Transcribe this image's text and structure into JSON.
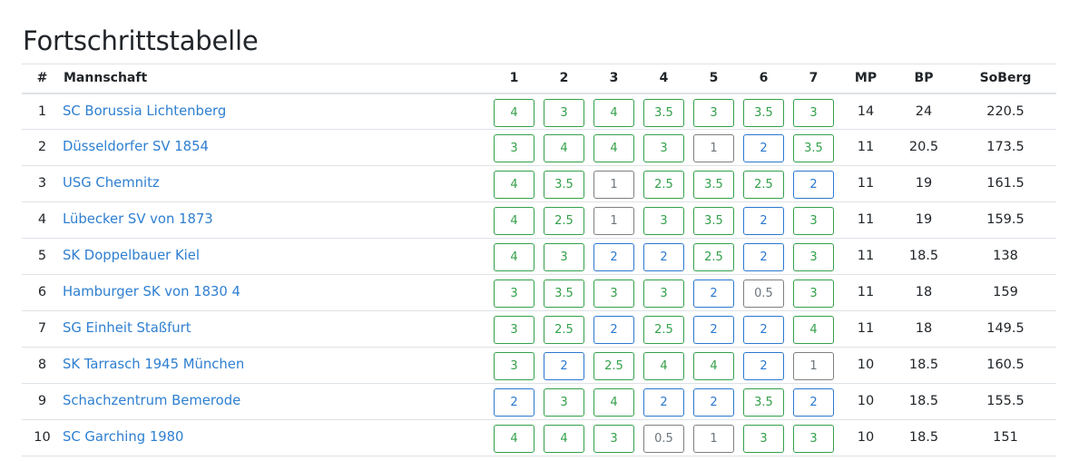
{
  "title": "Fortschrittstabelle",
  "headers": {
    "rank": "#",
    "team": "Mannschaft",
    "rounds": [
      "1",
      "2",
      "3",
      "4",
      "5",
      "6",
      "7"
    ],
    "mp": "MP",
    "bp": "BP",
    "soberg": "SoBerg"
  },
  "colors": {
    "win": "#33a04a",
    "draw": "#2b78cf",
    "loss": "#7f7f7f",
    "link": "#2e7fd1"
  },
  "rows": [
    {
      "rank": "1",
      "team": "SC Borussia Lichtenberg",
      "results": [
        "4",
        "3",
        "4",
        "3.5",
        "3",
        "3.5",
        "3"
      ],
      "status": [
        "win",
        "win",
        "win",
        "win",
        "win",
        "win",
        "win"
      ],
      "mp": "14",
      "bp": "24",
      "soberg": "220.5"
    },
    {
      "rank": "2",
      "team": "Düsseldorfer SV 1854",
      "results": [
        "3",
        "4",
        "4",
        "3",
        "1",
        "2",
        "3.5"
      ],
      "status": [
        "win",
        "win",
        "win",
        "win",
        "loss",
        "draw",
        "win"
      ],
      "mp": "11",
      "bp": "20.5",
      "soberg": "173.5"
    },
    {
      "rank": "3",
      "team": "USG Chemnitz",
      "results": [
        "4",
        "3.5",
        "1",
        "2.5",
        "3.5",
        "2.5",
        "2"
      ],
      "status": [
        "win",
        "win",
        "loss",
        "win",
        "win",
        "win",
        "draw"
      ],
      "mp": "11",
      "bp": "19",
      "soberg": "161.5"
    },
    {
      "rank": "4",
      "team": "Lübecker SV von 1873",
      "results": [
        "4",
        "2.5",
        "1",
        "3",
        "3.5",
        "2",
        "3"
      ],
      "status": [
        "win",
        "win",
        "loss",
        "win",
        "win",
        "draw",
        "win"
      ],
      "mp": "11",
      "bp": "19",
      "soberg": "159.5"
    },
    {
      "rank": "5",
      "team": "SK Doppelbauer Kiel",
      "results": [
        "4",
        "3",
        "2",
        "2",
        "2.5",
        "2",
        "3"
      ],
      "status": [
        "win",
        "win",
        "draw",
        "draw",
        "win",
        "draw",
        "win"
      ],
      "mp": "11",
      "bp": "18.5",
      "soberg": "138"
    },
    {
      "rank": "6",
      "team": "Hamburger SK von 1830 4",
      "results": [
        "3",
        "3.5",
        "3",
        "3",
        "2",
        "0.5",
        "3"
      ],
      "status": [
        "win",
        "win",
        "win",
        "win",
        "draw",
        "loss",
        "win"
      ],
      "mp": "11",
      "bp": "18",
      "soberg": "159"
    },
    {
      "rank": "7",
      "team": "SG Einheit Staßfurt",
      "results": [
        "3",
        "2.5",
        "2",
        "2.5",
        "2",
        "2",
        "4"
      ],
      "status": [
        "win",
        "win",
        "draw",
        "win",
        "draw",
        "draw",
        "win"
      ],
      "mp": "11",
      "bp": "18",
      "soberg": "149.5"
    },
    {
      "rank": "8",
      "team": "SK Tarrasch 1945 München",
      "results": [
        "3",
        "2",
        "2.5",
        "4",
        "4",
        "2",
        "1"
      ],
      "status": [
        "win",
        "draw",
        "win",
        "win",
        "win",
        "draw",
        "loss"
      ],
      "mp": "10",
      "bp": "18.5",
      "soberg": "160.5"
    },
    {
      "rank": "9",
      "team": "Schachzentrum Bemerode",
      "results": [
        "2",
        "3",
        "4",
        "2",
        "2",
        "3.5",
        "2"
      ],
      "status": [
        "draw",
        "win",
        "win",
        "draw",
        "draw",
        "win",
        "draw"
      ],
      "mp": "10",
      "bp": "18.5",
      "soberg": "155.5"
    },
    {
      "rank": "10",
      "team": "SC Garching 1980",
      "results": [
        "4",
        "4",
        "3",
        "0.5",
        "1",
        "3",
        "3"
      ],
      "status": [
        "win",
        "win",
        "win",
        "loss",
        "loss",
        "win",
        "win"
      ],
      "mp": "10",
      "bp": "18.5",
      "soberg": "151"
    }
  ]
}
